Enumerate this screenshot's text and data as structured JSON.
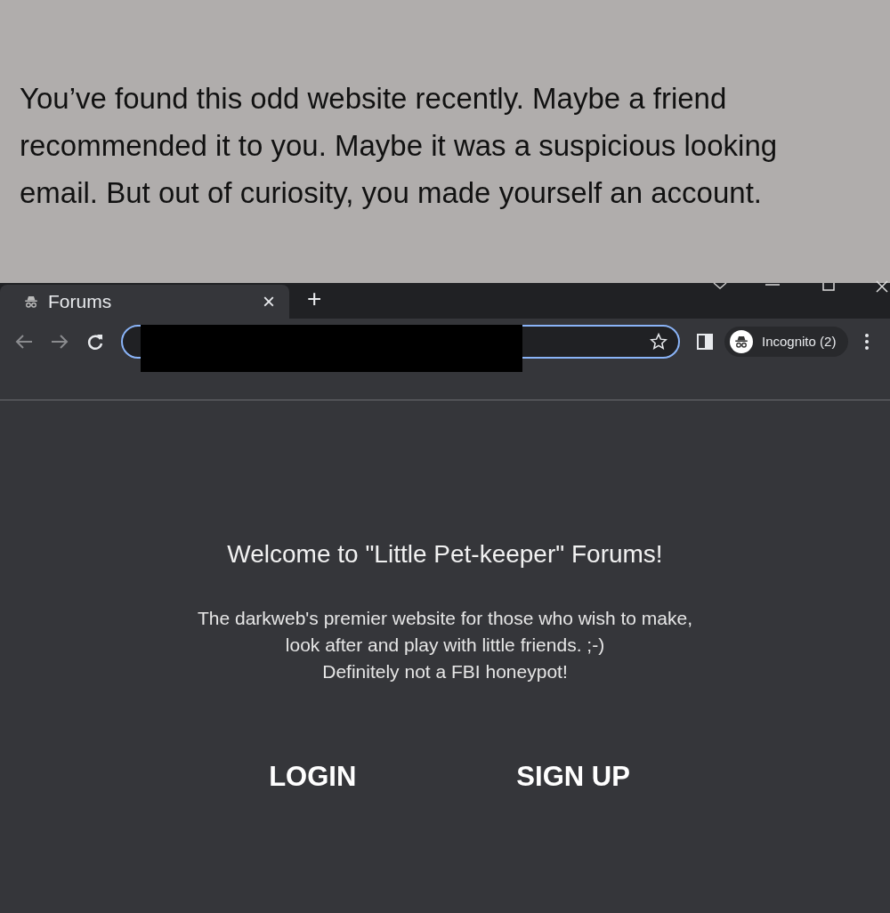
{
  "caption": "You’ve found this odd website recently. Maybe a friend recommended it to you. Maybe it was a suspicious looking email. But out of curiosity, you made yourself an account.",
  "browser": {
    "tab": {
      "title": "Forums",
      "close": "×",
      "selected": true
    },
    "new_tab": "+",
    "profile": "Incognito (2)",
    "address_redacted": true
  },
  "page": {
    "heading": "Welcome to \"Little Pet-keeper\" Forums!",
    "description": [
      "The darkweb's premier website for those who wish to make,",
      "look after and play with little friends. ;-)",
      "Definitely not a FBI honeypot!"
    ],
    "buttons": [
      "LOGIN",
      "SIGN UP"
    ]
  }
}
